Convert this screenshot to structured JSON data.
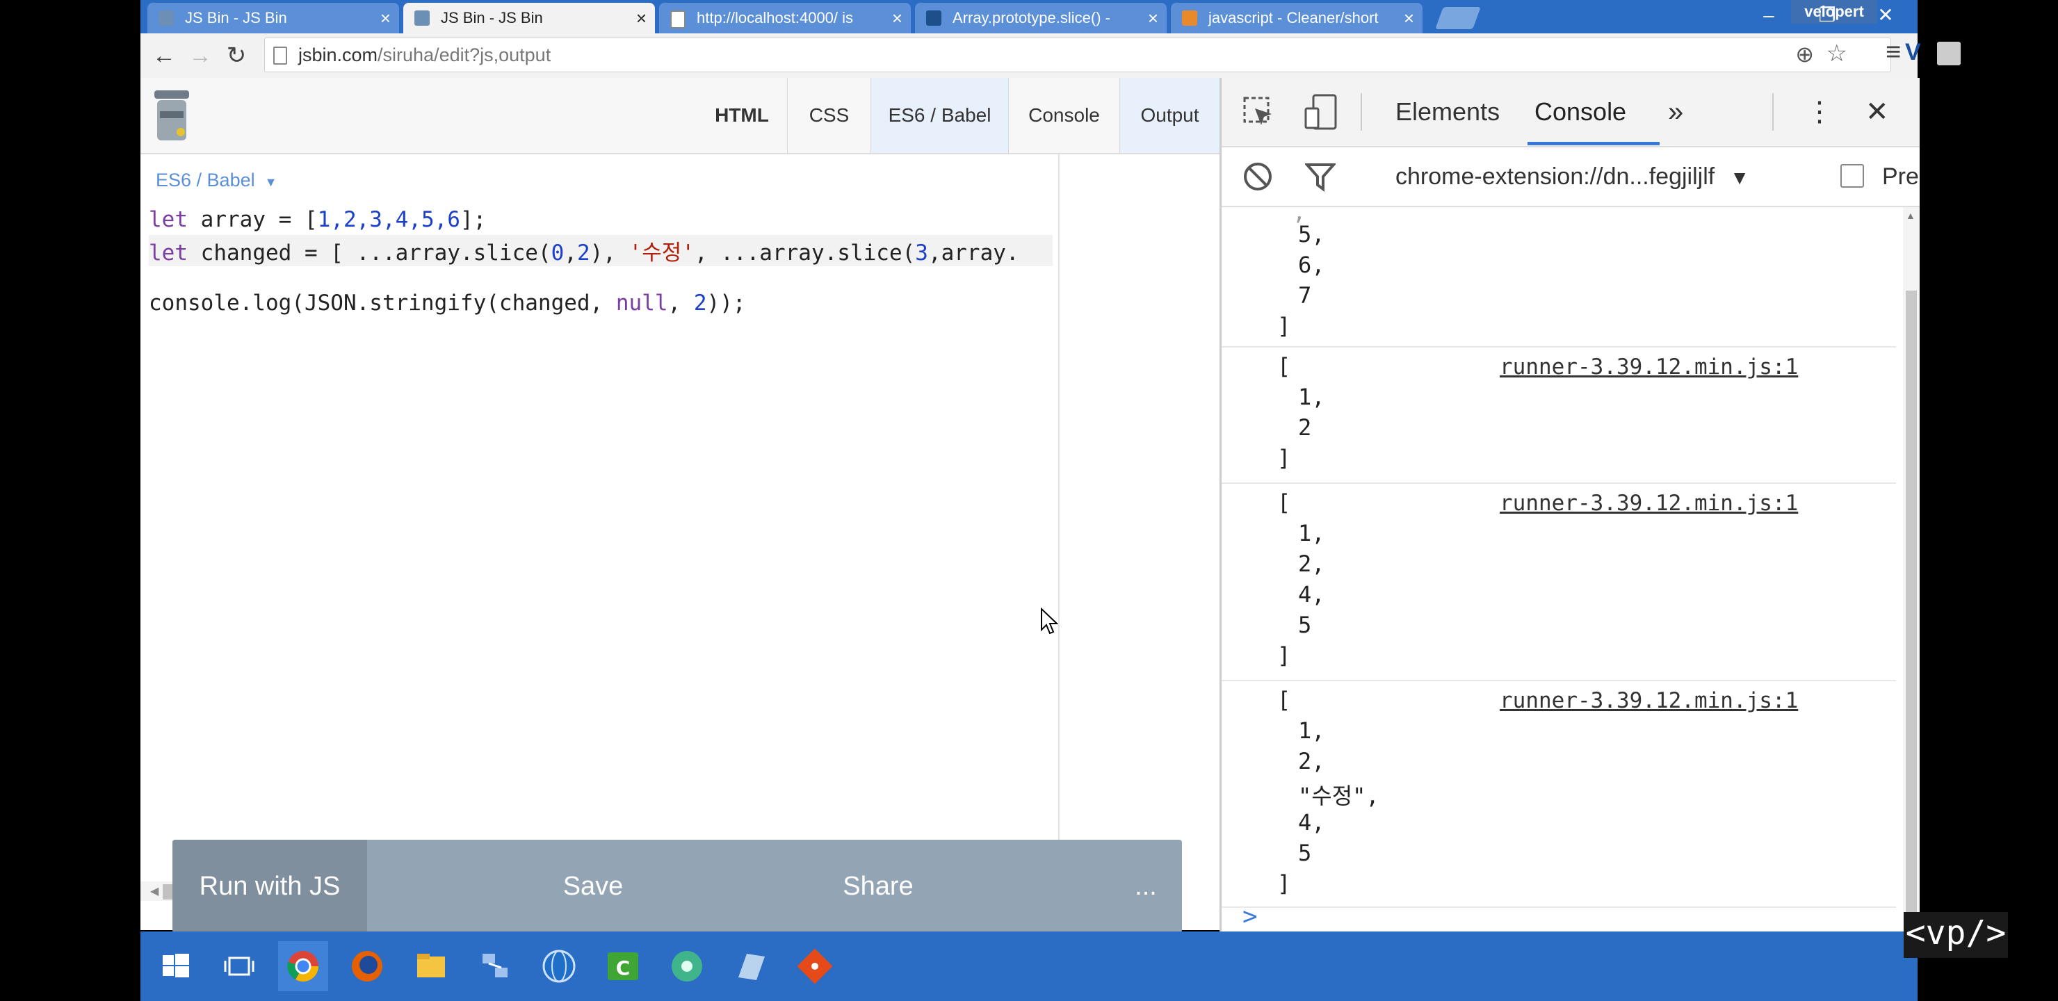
{
  "browser": {
    "tabs": [
      {
        "title": "JS Bin - JS Bin",
        "icon": "jsbin-icon"
      },
      {
        "title": "JS Bin - JS Bin",
        "icon": "jsbin-icon"
      },
      {
        "title": "http://localhost:4000/ is",
        "icon": "page-icon"
      },
      {
        "title": "Array.prototype.slice() -",
        "icon": "mdn-icon"
      },
      {
        "title": "javascript - Cleaner/short",
        "icon": "stackoverflow-icon"
      }
    ],
    "user": "velopert",
    "url_host": "jsbin.com",
    "url_path": "/siruha/edit?js,output"
  },
  "jsbin": {
    "panel_tabs": [
      "HTML",
      "CSS",
      "ES6 / Babel",
      "Console",
      "Output"
    ],
    "editor_label": "ES6 / Babel",
    "code": {
      "l1_kw": "let",
      "l1_a": " array = [",
      "l1_nums": "1,2,3,4,5,6",
      "l1_b": "];",
      "l2_kw": "let",
      "l2_a": " changed = [ ...array.slice(",
      "l2_n1": "0",
      "l2_c": ",",
      "l2_n2": "2",
      "l2_d": "), ",
      "l2_str": "'수정'",
      "l2_e": ", ...array.slice(",
      "l2_n3": "3",
      "l2_f": ",array.",
      "l3_a": "console.log(JSON.stringify(changed, ",
      "l3_null": "null",
      "l3_b": ", ",
      "l3_n": "2",
      "l3_c": "));"
    },
    "buttons": {
      "run": "Run with JS",
      "save": "Save",
      "share": "Share",
      "more": "..."
    }
  },
  "devtools": {
    "tabs": [
      "Elements",
      "Console"
    ],
    "more": "»",
    "context": "chrome-extension://dn...fegjiljlf",
    "preserve": "Pre",
    "source": "runner-3.39.12.min.js:1",
    "prompt": ">",
    "log0": [
      "5,",
      "6,",
      "7",
      "]"
    ],
    "log1": [
      "[",
      "1,",
      "2",
      "]"
    ],
    "log2": [
      "[",
      "1,",
      "2,",
      "4,",
      "5",
      "]"
    ],
    "log3": [
      "[",
      "1,",
      "2,",
      "\"수정\",",
      "4,",
      "5",
      "]"
    ]
  },
  "watermark": "<vp/>"
}
